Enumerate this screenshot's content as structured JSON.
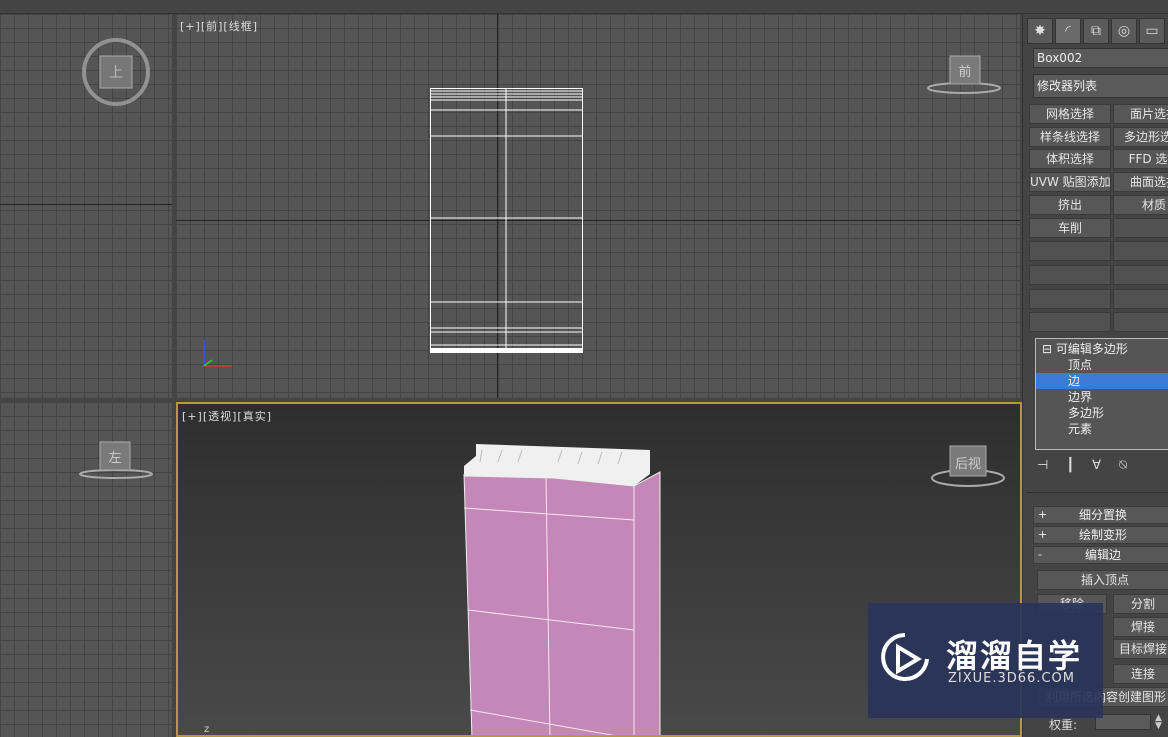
{
  "viewports": {
    "front": {
      "label_bracket": "[+]",
      "label_view": "[前]",
      "label_mode": "[线框]",
      "cube_label": "前"
    },
    "top_left": {
      "cube_label": "上"
    },
    "left": {
      "cube_label": "左"
    },
    "perspective": {
      "label_bracket": "[+]",
      "label_view": "[透视]",
      "label_mode": "[真实]",
      "cube_label": "后视"
    }
  },
  "panel": {
    "object_name": "Box002",
    "modifier_list": "修改器列表",
    "buttons": [
      [
        "网格选择",
        "面片选择"
      ],
      [
        "样条线选择",
        "多边形选择"
      ],
      [
        "体积选择",
        "FFD 选择"
      ],
      [
        "UVW 贴图添加",
        "曲面选择"
      ],
      [
        "挤出",
        "材质"
      ],
      [
        "车削",
        ""
      ]
    ],
    "stack": {
      "root": "可编辑多边形",
      "items": [
        "顶点",
        "边",
        "边界",
        "多边形",
        "元素"
      ],
      "selected_index": 1
    },
    "rollouts": [
      {
        "sign": "+",
        "label": "细分置换"
      },
      {
        "sign": "+",
        "label": "绘制变形"
      },
      {
        "sign": "-",
        "label": "编辑边"
      }
    ],
    "edit_edge": {
      "insert_vertex": "插入顶点",
      "remove": "移除",
      "split": "分割",
      "weld": "焊接",
      "target_weld": "目标焊接",
      "connect": "连接",
      "create_shape": "利用所选内容创建图形",
      "weight_label": "权重:"
    }
  },
  "watermark": {
    "brand": "溜溜自学",
    "url": "ZIXUE.3D66.COM"
  },
  "colors": {
    "selection": "#3d7ad8",
    "active_border": "#b89838",
    "mesh": "#c488b8"
  }
}
